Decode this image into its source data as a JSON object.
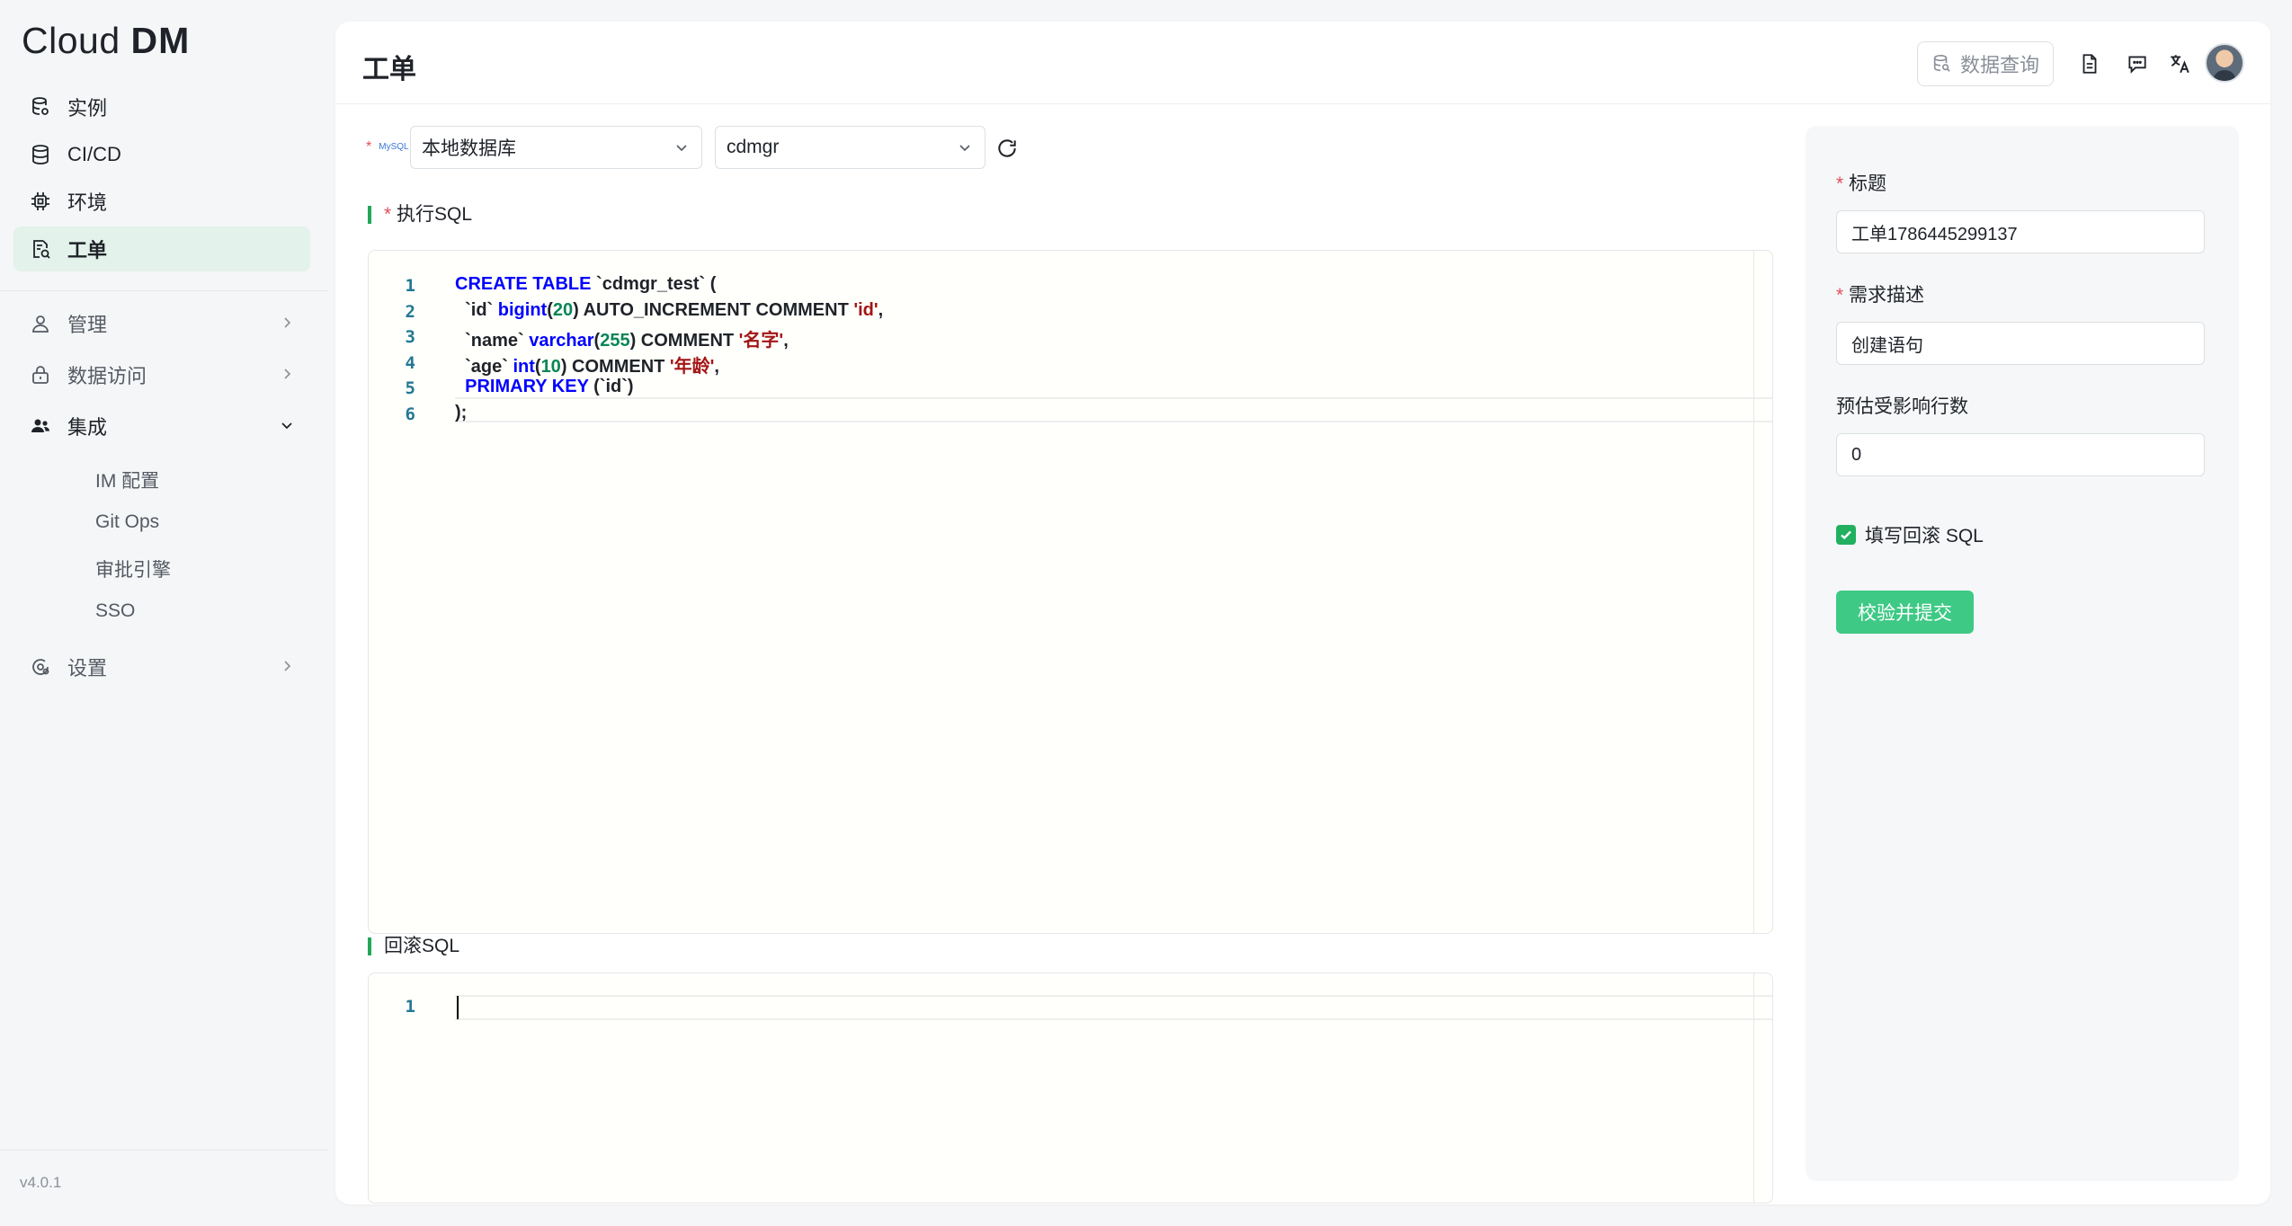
{
  "app": {
    "logo_light": "Cloud",
    "logo_bold": "DM",
    "version": "v4.0.1"
  },
  "sidebar": {
    "items": [
      {
        "label": "实例",
        "icon": "database-stack-icon"
      },
      {
        "label": "CI/CD",
        "icon": "database-icon"
      },
      {
        "label": "环境",
        "icon": "chip-icon"
      },
      {
        "label": "工单",
        "icon": "ticket-icon",
        "active": true
      }
    ],
    "groups": [
      {
        "label": "管理",
        "icon": "user-icon"
      },
      {
        "label": "数据访问",
        "icon": "lock-icon"
      },
      {
        "label": "集成",
        "icon": "team-icon",
        "expanded": true
      },
      {
        "label": "设置",
        "icon": "settings-icon"
      }
    ],
    "integration_children": [
      "IM 配置",
      "Git Ops",
      "审批引擎",
      "SSO"
    ]
  },
  "header": {
    "title": "工单",
    "query_button": "数据查询",
    "icons": [
      "document-icon",
      "chat-icon",
      "translate-icon",
      "avatar"
    ]
  },
  "datasource": {
    "db_type_logo": "MySQL",
    "instance": "本地数据库",
    "schema": "cdmgr"
  },
  "sql_section": {
    "label": "执行SQL",
    "required_mark": "*",
    "line_numbers": [
      "1",
      "2",
      "3",
      "4",
      "5",
      "6"
    ]
  },
  "rollback_section": {
    "label": "回滚SQL",
    "line_numbers": [
      "1"
    ]
  },
  "form": {
    "title_label": "标题",
    "title_value": "工单1786445299137",
    "desc_label": "需求描述",
    "desc_value": "创建语句",
    "rows_label": "预估受影响行数",
    "rows_value": "0",
    "rollback_checkbox_label": "填写回滚 SQL",
    "rollback_checked": true,
    "submit_label": "校验并提交"
  },
  "colors": {
    "accent": "#3ec985",
    "active_bg": "#e3f2ea",
    "section_bar": "#22a75a",
    "keyword": "#0000ff",
    "number": "#098658",
    "string": "#a31515"
  }
}
